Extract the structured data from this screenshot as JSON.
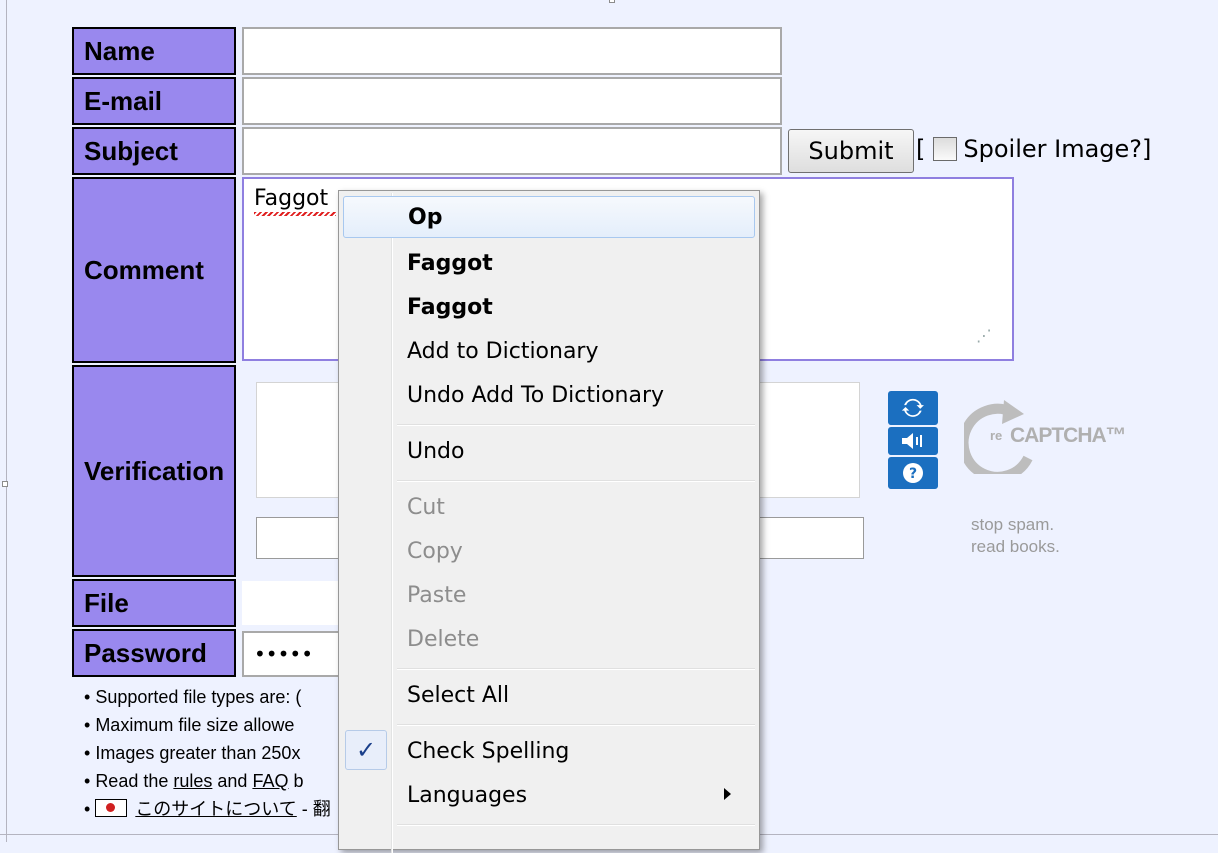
{
  "form": {
    "labels": {
      "name": "Name",
      "email": "E-mail",
      "subject": "Subject",
      "comment": "Comment",
      "verification": "Verification",
      "file": "File",
      "password": "Password"
    },
    "comment_value": "Faggot",
    "password_value": "•••••",
    "submit_label": "Submit",
    "spoiler_open": "[",
    "spoiler_label": "Spoiler Image?]"
  },
  "recaptcha": {
    "logo_re": "re",
    "logo_captcha": "CAPTCHA™",
    "tagline_1": "stop spam.",
    "tagline_2": "read books.",
    "icons": [
      "refresh-icon",
      "audio-icon",
      "help-icon"
    ]
  },
  "notes": {
    "line1": "Supported file types are: (",
    "line2": "Maximum file size allowe",
    "line3": "Images greater than 250x",
    "line4_pre": "Read the ",
    "line4_rules": "rules",
    "line4_mid": " and ",
    "line4_faq": "FAQ",
    "line4_post": " b",
    "line5_link": "このサイトについて",
    "line5_post": " - 翻"
  },
  "context_menu": {
    "items": [
      {
        "label": "Op",
        "bold": true,
        "highlight": true
      },
      {
        "label": "Faggot",
        "bold": true
      },
      {
        "label": "Faggot",
        "bold": true
      },
      {
        "label": "Add to Dictionary"
      },
      {
        "label": "Undo Add To Dictionary"
      },
      {
        "label": "Undo"
      },
      {
        "label": "Cut",
        "disabled": true
      },
      {
        "label": "Copy",
        "disabled": true
      },
      {
        "label": "Paste",
        "disabled": true
      },
      {
        "label": "Delete",
        "disabled": true
      },
      {
        "label": "Select All"
      },
      {
        "label": "Check Spelling",
        "checked": true
      },
      {
        "label": "Languages",
        "submenu": true
      }
    ],
    "check_mark": "✓"
  },
  "colors": {
    "label_bg": "#9988ee",
    "page_bg": "#eef2ff",
    "recaptcha_blue": "#1b6fc0",
    "menu_highlight_border": "#a8c8ef"
  }
}
